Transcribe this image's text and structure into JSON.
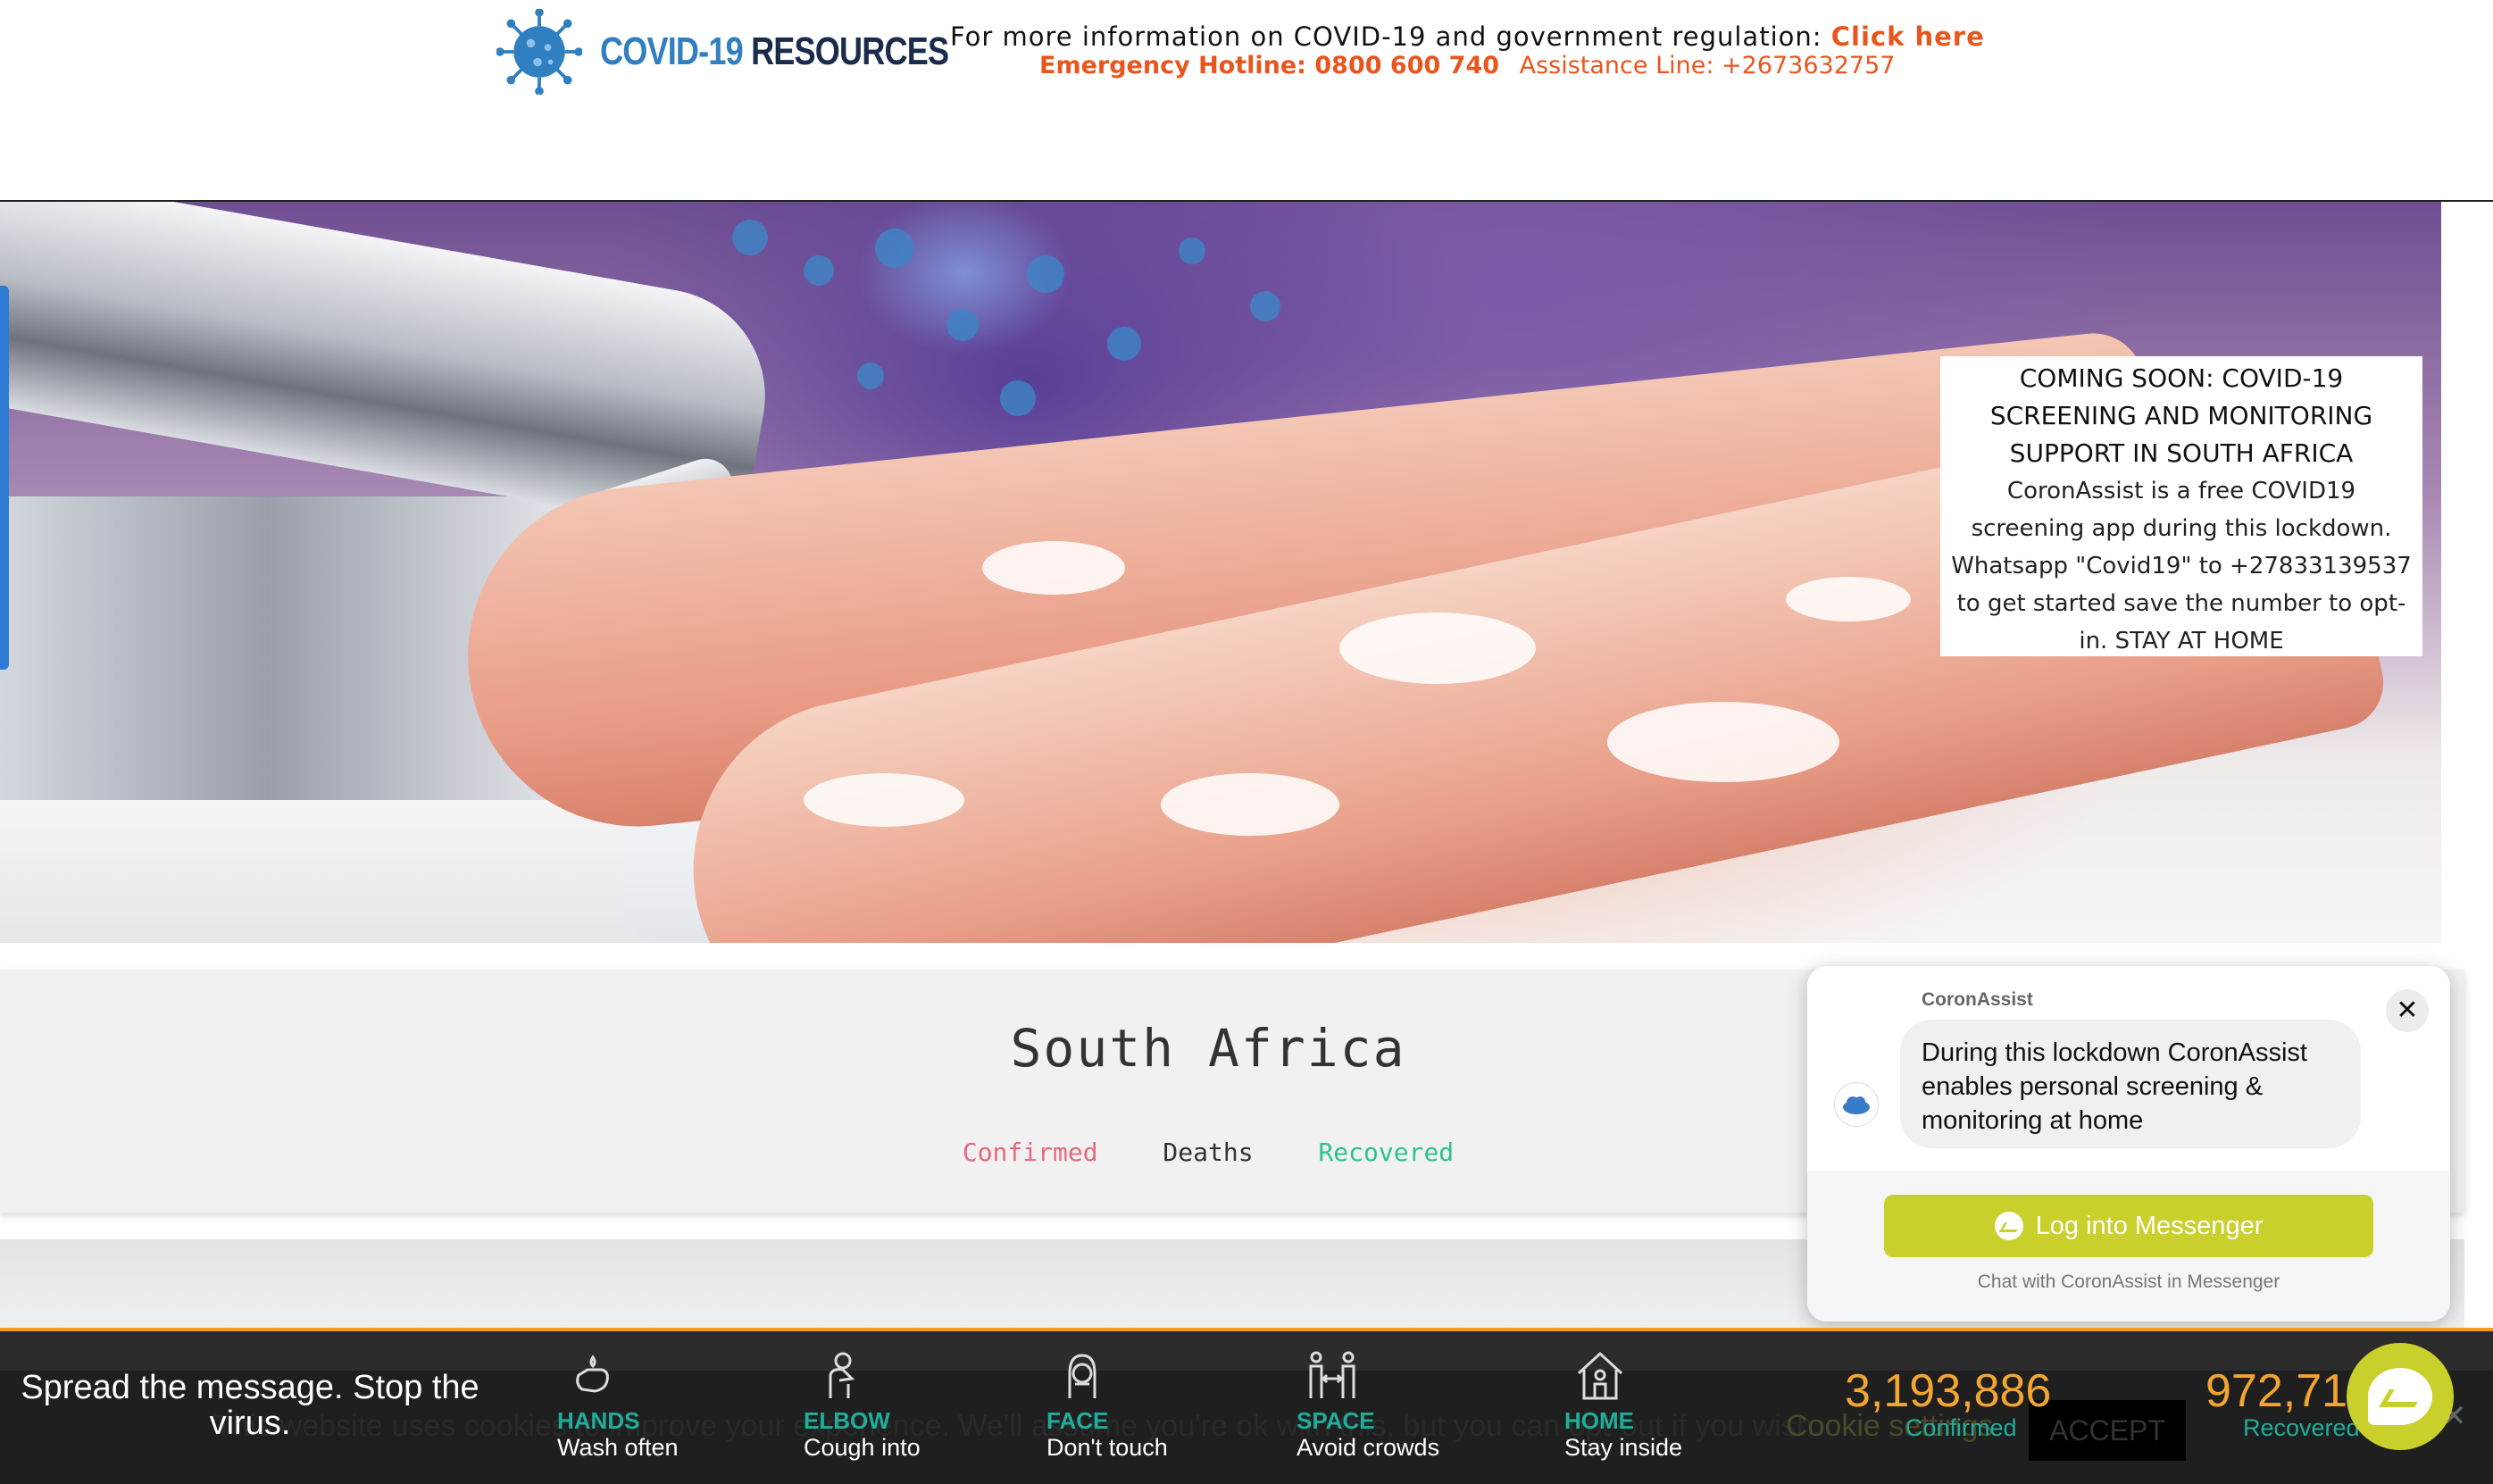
{
  "header": {
    "logo_covid": "COVID-19",
    "logo_resources": "RESOURCES",
    "info_text": "For more information on COVID-19 and government regulation:",
    "info_link": "Click here",
    "hotline": "Emergency Hotline: 0800 600 740",
    "assistance": "Assistance Line: +2673632757"
  },
  "notice": {
    "title": "COMING SOON: COVID-19 SCREENING AND MONITORING SUPPORT IN SOUTH AFRICA",
    "body": "CoronAssist is a free COVID19 screening app during this lockdown. Whatsapp \"Covid19\" to +27833139537 to get started save the number to opt-in. STAY AT HOME"
  },
  "stats": {
    "country": "South Africa",
    "tabs": [
      "Confirmed",
      "Deaths",
      "Recovered"
    ]
  },
  "chat": {
    "name": "CoronAssist",
    "message": "During this lockdown CoronAssist enables personal screening & monitoring at home",
    "button": "Log into Messenger",
    "caption": "Chat with CoronAssist in Messenger",
    "close": "✕"
  },
  "cookie": {
    "text": "This website uses cookies to improve your experience. We'll assume you're ok with this, but you can opt-out if you wish.",
    "settings": "Cookie settings",
    "accept": "ACCEPT",
    "close": "✕"
  },
  "bottom": {
    "spread": "Spread the message. Stop the virus.",
    "tips": [
      {
        "label": "HANDS",
        "sub": "Wash often"
      },
      {
        "label": "ELBOW",
        "sub": "Cough into"
      },
      {
        "label": "FACE",
        "sub": "Don't touch"
      },
      {
        "label": "SPACE",
        "sub": "Avoid crowds"
      },
      {
        "label": "HOME",
        "sub": "Stay inside"
      }
    ],
    "confirmed_value": "3,193,886",
    "confirmed_label": "Confirmed",
    "recovered_value": "972,71",
    "recovered_label": "Recovered"
  },
  "colors": {
    "accent_orange": "#e8561e",
    "teal": "#1fae9b",
    "messenger_green": "#c9d02c"
  }
}
